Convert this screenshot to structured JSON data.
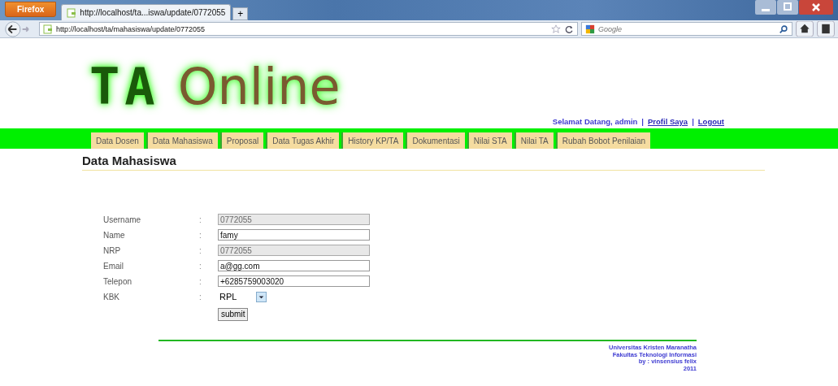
{
  "browser": {
    "menu_button": "Firefox",
    "tab_title": "http://localhost/ta...iswa/update/0772055",
    "new_tab": "+",
    "address": "http://localhost/ta/mahasiswa/update/0772055",
    "search_placeholder": "Google"
  },
  "logo": {
    "mark": "TA",
    "word": "Online"
  },
  "user_bar": {
    "greeting": "Selamat Datang, admin",
    "separator_1": "|",
    "profile_link": "Profil Saya",
    "separator_2": "|",
    "logout_link": "Logout"
  },
  "nav_tabs": [
    {
      "label": "Data Dosen",
      "selected": false
    },
    {
      "label": "Data Mahasiswa",
      "selected": false
    },
    {
      "label": "Proposal",
      "selected": false
    },
    {
      "label": "Data Tugas Akhir",
      "selected": false
    },
    {
      "label": "History KP/TA",
      "selected": false
    },
    {
      "label": "Dokumentasi",
      "selected": false
    },
    {
      "label": "Nilai STA",
      "selected": false
    },
    {
      "label": "Nilai TA",
      "selected": false
    },
    {
      "label": "Rubah Bobot Penilaian",
      "selected": false
    }
  ],
  "page_title": "Data Mahasiswa",
  "form": {
    "fields": [
      {
        "label": "Username",
        "colon": ":",
        "kind": "text",
        "value": "0772055",
        "disabled": true
      },
      {
        "label": "Name",
        "colon": ":",
        "kind": "text",
        "value": "famy",
        "disabled": false
      },
      {
        "label": "NRP",
        "colon": ":",
        "kind": "text",
        "value": "0772055",
        "disabled": true
      },
      {
        "label": "Email",
        "colon": ":",
        "kind": "text",
        "value": "a@gg.com",
        "disabled": false
      },
      {
        "label": "Telepon",
        "colon": ":",
        "kind": "text",
        "value": "+6285759003020",
        "disabled": false
      },
      {
        "label": "KBK",
        "colon": ":",
        "kind": "select",
        "value": "RPL",
        "disabled": false
      }
    ],
    "submit": "submit"
  },
  "footer": {
    "lines": [
      "Universitas Kristen Maranatha",
      "Fakultas Teknologi Informasi",
      "by : vinsensius felix",
      "2011"
    ]
  }
}
